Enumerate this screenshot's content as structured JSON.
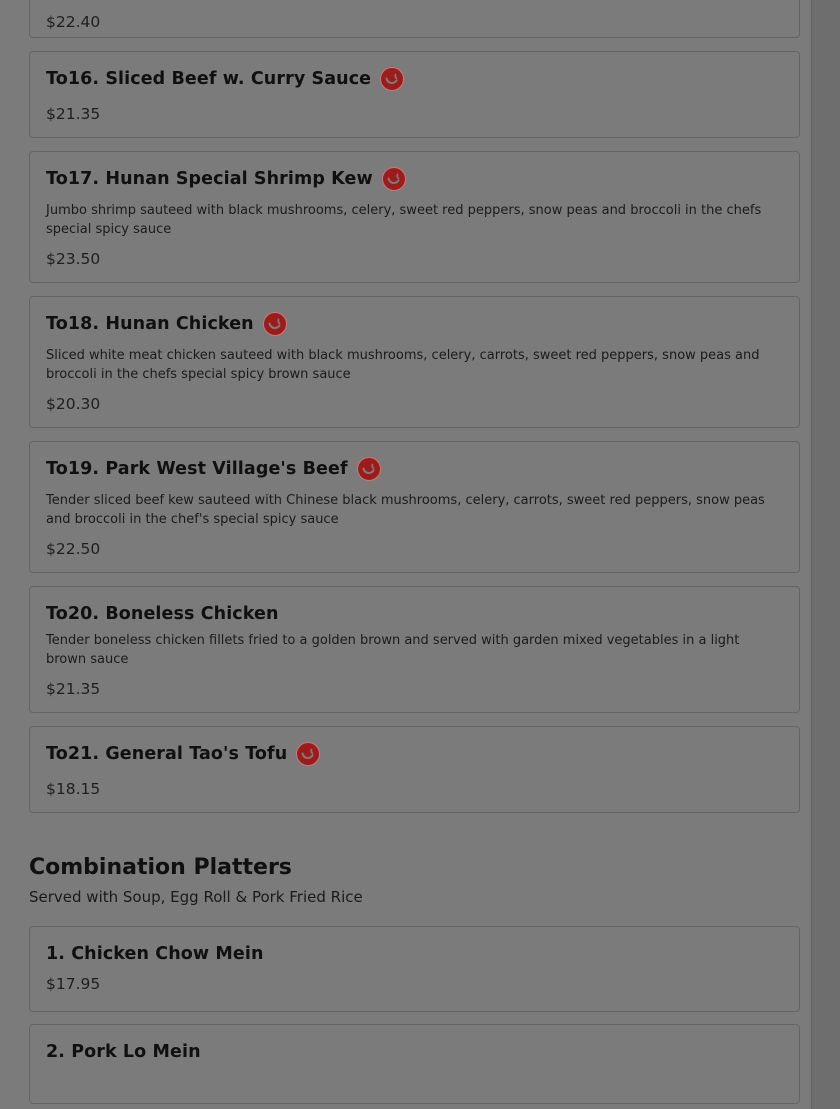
{
  "menu": {
    "previous_item": {
      "price": "$22.40"
    },
    "items": [
      {
        "title": "To16. Sliced Beef w. Curry Sauce",
        "spicy": true,
        "description": "",
        "price": "$21.35"
      },
      {
        "title": "To17. Hunan Special Shrimp Kew",
        "spicy": true,
        "description": "Jumbo shrimp sauteed with black mushrooms, celery, sweet red peppers, snow peas and broccoli in the chefs special spicy sauce",
        "price": "$23.50"
      },
      {
        "title": "To18. Hunan Chicken",
        "spicy": true,
        "description": "Sliced white meat chicken sauteed with black mushrooms, celery, carrots, sweet red peppers, snow peas and broccoli in the chefs special spicy brown sauce",
        "price": "$20.30"
      },
      {
        "title": "To19. Park West Village's Beef",
        "spicy": true,
        "description": "Tender sliced beef kew sauteed with Chinese black mushrooms, celery, carrots, sweet red peppers, snow peas and broccoli in the chef's special spicy sauce",
        "price": "$22.50"
      },
      {
        "title": "To20. Boneless Chicken",
        "spicy": false,
        "description": "Tender boneless chicken fillets fried to a golden brown and served with garden mixed vegetables in a light brown sauce",
        "price": "$21.35"
      },
      {
        "title": "To21. General Tao's Tofu",
        "spicy": true,
        "description": "",
        "price": "$18.15"
      }
    ],
    "combination_section": {
      "title": "Combination Platters",
      "subtitle": "Served with Soup, Egg Roll & Pork Fried Rice",
      "items": [
        {
          "title": "1. Chicken Chow Mein",
          "price": "$17.95"
        },
        {
          "title": "2. Pork Lo Mein",
          "price": ""
        }
      ]
    },
    "spicy_icon_name": "spicy-pepper-icon",
    "spicy_icon_color": "#9e1b1b"
  }
}
